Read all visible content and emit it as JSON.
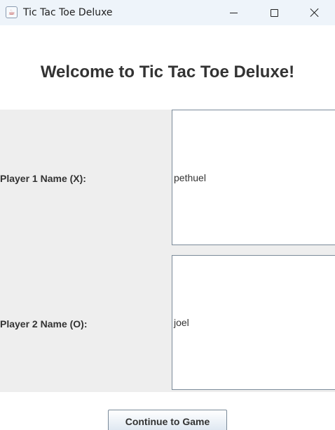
{
  "window": {
    "title": "Tic Tac Toe Deluxe",
    "icon": "java-cup-icon",
    "controls": [
      "minimize-icon",
      "maximize-icon",
      "close-icon"
    ]
  },
  "main": {
    "heading": "Welcome to Tic Tac Toe Deluxe!",
    "player1": {
      "label": "Player 1 Name (X):",
      "value": "pethuel"
    },
    "player2": {
      "label": "Player 2 Name (O):",
      "value": "joel"
    },
    "continue_label": "Continue to Game"
  }
}
